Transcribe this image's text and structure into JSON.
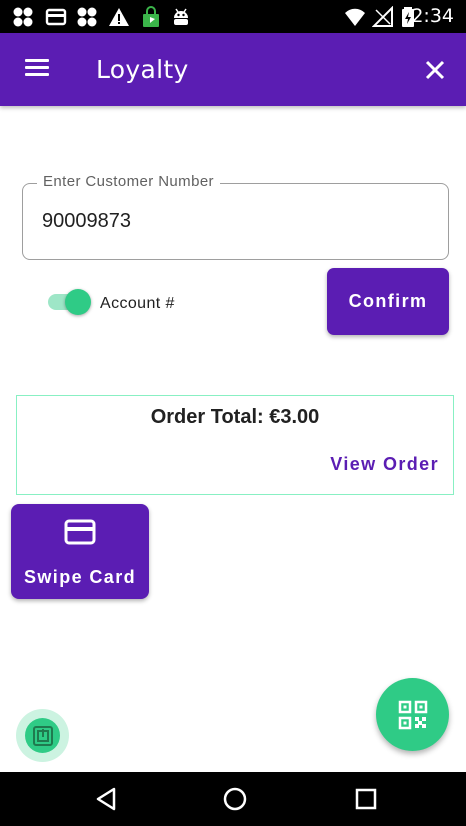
{
  "status_bar": {
    "time": "2:34",
    "icons": [
      "clover-icon",
      "card-icon",
      "clover-icon",
      "warning-icon",
      "shopping-bag-icon",
      "android-icon",
      "wifi-icon",
      "signal-icon",
      "battery-icon"
    ]
  },
  "app_bar": {
    "title": "Loyalty",
    "menu_icon": "hamburger-menu-icon",
    "close_icon": "close-icon"
  },
  "customer_field": {
    "label": "Enter Customer Number",
    "value": "90009873"
  },
  "account_toggle": {
    "label": "Account #",
    "checked": true
  },
  "confirm_button": {
    "label": "Confirm"
  },
  "order": {
    "total_label": "Order Total: €3.00",
    "view_order_label": "View Order"
  },
  "swipe_button": {
    "label": "Swipe Card",
    "icon": "credit-card-icon"
  },
  "nfc_badge": {
    "icon": "nfc-icon"
  },
  "qr_fab": {
    "icon": "qr-code-icon"
  },
  "nav_bar": {
    "icons": [
      "back-icon",
      "home-icon",
      "recents-icon"
    ]
  },
  "colors": {
    "primary": "#5b1db3",
    "accent": "#2fcb86",
    "card_border": "#88f0c3"
  }
}
